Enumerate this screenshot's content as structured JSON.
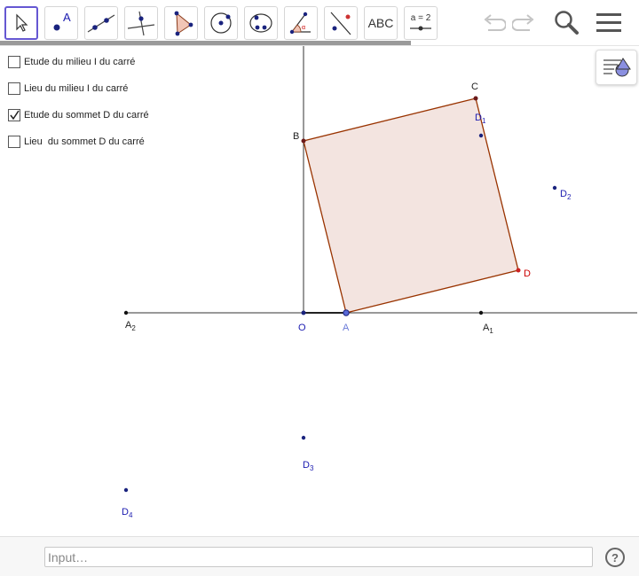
{
  "toolbar": {
    "tools": [
      {
        "name": "move-tool",
        "icon": "cursor-arrow-icon"
      },
      {
        "name": "point-tool",
        "icon": "point-icon",
        "label": "A"
      },
      {
        "name": "line-tool",
        "icon": "line-through-points-icon"
      },
      {
        "name": "perpendicular-tool",
        "icon": "perpendicular-line-icon"
      },
      {
        "name": "polygon-tool",
        "icon": "polygon-icon"
      },
      {
        "name": "circle-tool",
        "icon": "circle-center-point-icon"
      },
      {
        "name": "ellipse-tool",
        "icon": "conic-icon"
      },
      {
        "name": "angle-tool",
        "icon": "angle-icon",
        "label": "α"
      },
      {
        "name": "reflect-tool",
        "icon": "reflect-about-line-icon"
      },
      {
        "name": "text-tool",
        "icon": "text-icon",
        "label": "ABC"
      },
      {
        "name": "slider-tool",
        "icon": "slider-icon",
        "label": "a = 2"
      }
    ],
    "selected_index": 0,
    "undo_icon": "undo-icon",
    "redo_icon": "redo-icon",
    "search_icon": "search-icon",
    "menu_icon": "hamburger-menu-icon"
  },
  "checkboxes": [
    {
      "label": "Etude du milieu I du carré",
      "checked": false
    },
    {
      "label": "Lieu du milieu I du carré",
      "checked": false
    },
    {
      "label": "Etude du sommet D du carré",
      "checked": true
    },
    {
      "label": "Lieu  du sommet D du carré",
      "checked": false
    }
  ],
  "graphics": {
    "points": {
      "O": {
        "label": "O"
      },
      "A": {
        "label": "A"
      },
      "A1": {
        "label": "A",
        "sub": "1"
      },
      "A2": {
        "label": "A",
        "sub": "2"
      },
      "B": {
        "label": "B"
      },
      "C": {
        "label": "C"
      },
      "D": {
        "label": "D"
      },
      "D1": {
        "label": "D",
        "sub": "1"
      },
      "D2": {
        "label": "D",
        "sub": "2"
      },
      "D3": {
        "label": "D",
        "sub": "3"
      },
      "D4": {
        "label": "D",
        "sub": "4"
      }
    },
    "colors": {
      "square_fill": "#f3e4e0",
      "square_stroke": "#993300",
      "axis": "#333333",
      "blue_point": "#1a237e",
      "blue_label": "#1b1bb0",
      "red_label": "#cc0000",
      "point_A_fill": "#5a6bd8"
    }
  },
  "stylebar": {
    "icon": "style-bar-toggle-icon"
  },
  "inputbar": {
    "placeholder": "Input…",
    "help_label": "?"
  }
}
